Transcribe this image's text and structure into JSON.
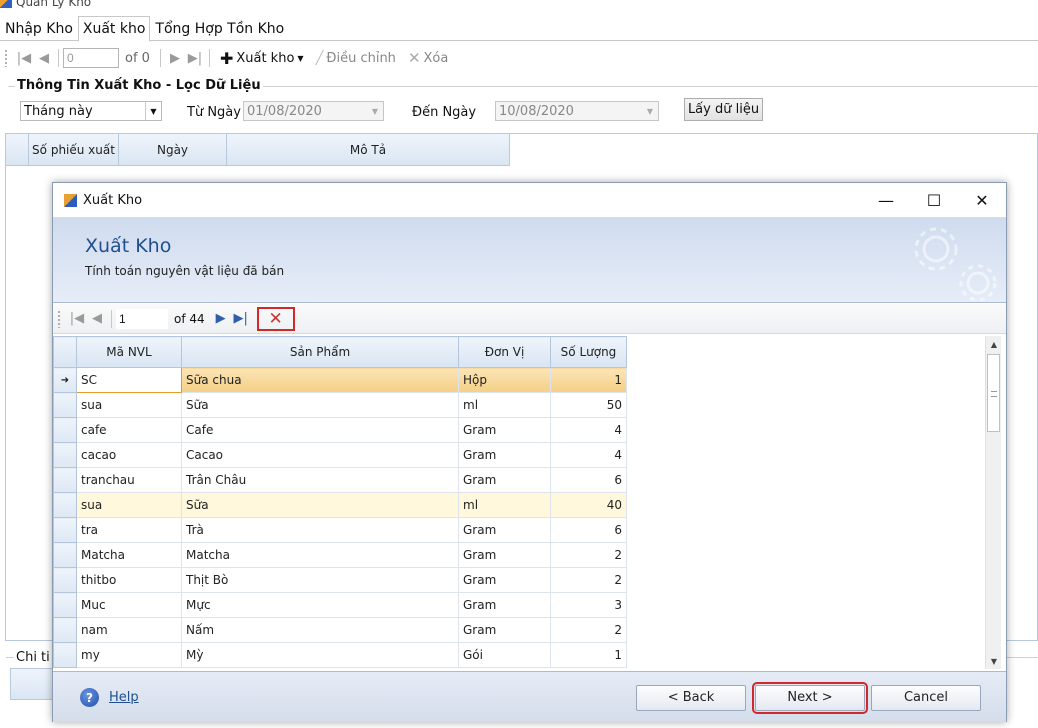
{
  "main_window": {
    "title": "Quản Lý Kho",
    "tabs": [
      "Nhập Kho",
      "Xuất kho",
      "Tổng Hợp Tồn Kho"
    ],
    "toolbar": {
      "position_value": "0",
      "of_count": "of 0",
      "export_label": "Xuất kho",
      "edit_label": "Điều chỉnh",
      "delete_label": "Xóa"
    },
    "filter": {
      "group_title": "Thông Tin Xuất Kho - Lọc Dữ Liệu",
      "period_value": "Tháng này",
      "from_label": "Từ Ngày",
      "from_value": "01/08/2020",
      "to_label": "Đến Ngày",
      "to_value": "10/08/2020",
      "fetch_label": "Lấy dữ liệu"
    },
    "grid_columns": [
      "Số phiếu xuất",
      "Ngày",
      "Mô Tả"
    ],
    "detail_group_title": "Chi ti"
  },
  "dialog": {
    "window_title": "Xuất Kho",
    "header_title": "Xuất Kho",
    "header_subtitle": "Tính toán nguyên vật liệu đã bán",
    "nav": {
      "position_value": "1",
      "of_count": "of 44"
    },
    "columns": [
      "Mã NVL",
      "Sản Phẩm",
      "Đơn Vị",
      "Số Lượng"
    ],
    "rows": [
      {
        "code": "SC",
        "product": "Sữa chua",
        "unit": "Hộp",
        "qty": "1"
      },
      {
        "code": "sua",
        "product": "Sữa",
        "unit": "ml",
        "qty": "50"
      },
      {
        "code": "cafe",
        "product": "Cafe",
        "unit": "Gram",
        "qty": "4"
      },
      {
        "code": "cacao",
        "product": "Cacao",
        "unit": "Gram",
        "qty": "4"
      },
      {
        "code": "tranchau",
        "product": "Trân Châu",
        "unit": "Gram",
        "qty": "6"
      },
      {
        "code": "sua",
        "product": "Sữa",
        "unit": "ml",
        "qty": "40"
      },
      {
        "code": "tra",
        "product": "Trà",
        "unit": "Gram",
        "qty": "6"
      },
      {
        "code": "Matcha",
        "product": "Matcha",
        "unit": "Gram",
        "qty": "2"
      },
      {
        "code": "thitbo",
        "product": "Thịt Bò",
        "unit": "Gram",
        "qty": "2"
      },
      {
        "code": "Muc",
        "product": "Mực",
        "unit": "Gram",
        "qty": "3"
      },
      {
        "code": "nam",
        "product": "Nấm",
        "unit": "Gram",
        "qty": "2"
      },
      {
        "code": "my",
        "product": "Mỳ",
        "unit": "Gói",
        "qty": "1"
      }
    ],
    "footer": {
      "help_label": "Help",
      "back_label": "<  Back",
      "next_label": "Next  >",
      "cancel_label": "Cancel"
    }
  },
  "colors": {
    "header_blue": "#1f4f8f",
    "highlight_red": "#d0292b",
    "selected_row": "#f5cf85",
    "alt_row": "#fff8dc"
  }
}
